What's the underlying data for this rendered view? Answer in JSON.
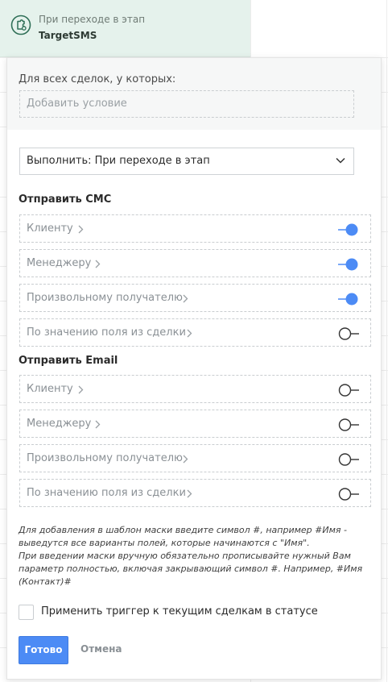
{
  "header": {
    "subtitle": "При переходе в этап",
    "title": "TargetSMS",
    "icon": "puzzle-gear-icon"
  },
  "conditions": {
    "label": "Для всех сделок, у которых:",
    "add_placeholder": "Добавить условие"
  },
  "execute_select": {
    "value": "Выполнить: При переходе в этап"
  },
  "sms_section": {
    "title": "Отправить СМС",
    "items": [
      {
        "label": "Клиенту",
        "enabled": true
      },
      {
        "label": "Менеджеру",
        "enabled": true
      },
      {
        "label": "Произвольному получателю",
        "enabled": true
      },
      {
        "label": "По значению поля из сделки",
        "enabled": false
      }
    ]
  },
  "email_section": {
    "title": "Отправить Email",
    "items": [
      {
        "label": "Клиенту",
        "enabled": false
      },
      {
        "label": "Менеджеру",
        "enabled": false
      },
      {
        "label": "Произвольному получателю",
        "enabled": false
      },
      {
        "label": "По значению поля из сделки",
        "enabled": false
      }
    ]
  },
  "hint": {
    "line1": "Для добавления в шаблон маски введите символ #, например #Имя - выведутся все варианты полей, которые начинаются с \"Имя\".",
    "line2": "При введении маски вручную обязательно прописывайте нужный Вам параметр полностью, включая закрывающий символ #. Например, #Имя (Контакт)#"
  },
  "apply_checkbox": {
    "label": "Применить триггер к текущим сделкам в статусе",
    "checked": false
  },
  "buttons": {
    "done": "Готово",
    "cancel": "Отмена"
  },
  "colors": {
    "accent": "#4c8bf5",
    "header_bg": "#e5f2ec",
    "header_icon": "#2f6f57"
  }
}
